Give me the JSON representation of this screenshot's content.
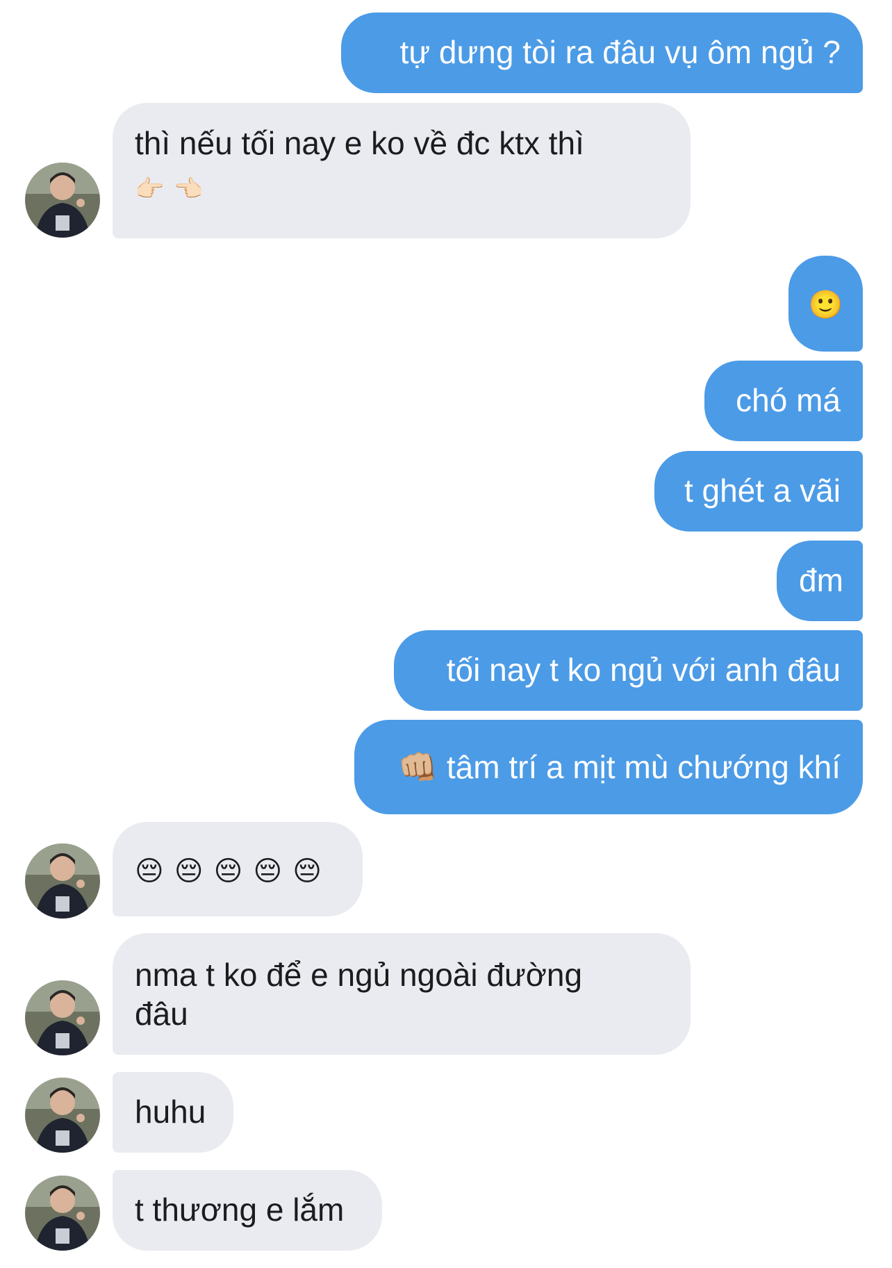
{
  "colors": {
    "outgoing_bubble": "#4c9be6",
    "incoming_bubble": "#e9ebf0",
    "outgoing_text": "#ffffff",
    "incoming_text": "#1c1c1e"
  },
  "messages": [
    {
      "id": "m1",
      "sender": "me",
      "text": "tự dưng tòi ra đâu vụ ôm ngủ ?"
    },
    {
      "id": "m2",
      "sender": "contact",
      "text": "thì nếu tối nay e ko về đc ktx thì",
      "emoji": "👉🏻👈🏻"
    },
    {
      "id": "m3",
      "sender": "me",
      "text": "🙂"
    },
    {
      "id": "m4",
      "sender": "me",
      "text": "chó má"
    },
    {
      "id": "m5",
      "sender": "me",
      "text": "t ghét a vãi"
    },
    {
      "id": "m6",
      "sender": "me",
      "text": "đm"
    },
    {
      "id": "m7",
      "sender": "me",
      "text": "tối nay t ko ngủ với anh đâu"
    },
    {
      "id": "m8",
      "sender": "me",
      "text": "👊🏼 tâm trí a mịt mù chướng khí"
    },
    {
      "id": "m9",
      "sender": "contact",
      "text": "😔 😔 😔 😔 😔"
    },
    {
      "id": "m10",
      "sender": "contact",
      "text": "nma t ko để e ngủ ngoài đường",
      "text_line2": "đâu"
    },
    {
      "id": "m11",
      "sender": "contact",
      "text": "huhu"
    },
    {
      "id": "m12",
      "sender": "contact",
      "text": "t thương e lắm"
    }
  ]
}
